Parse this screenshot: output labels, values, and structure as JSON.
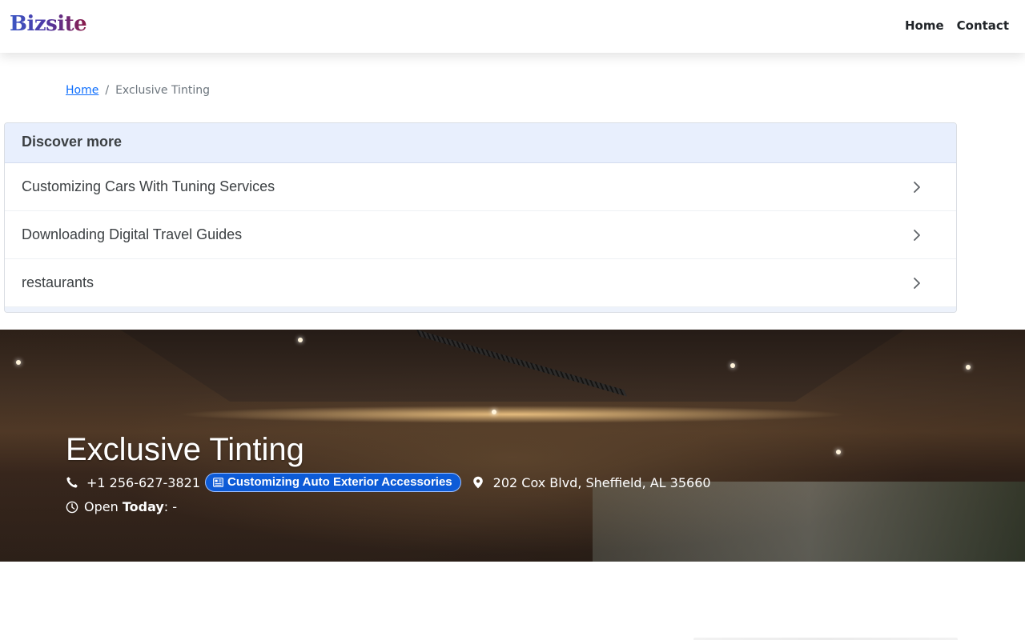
{
  "header": {
    "logo": "Bizsite",
    "nav": [
      {
        "label": "Home"
      },
      {
        "label": "Contact"
      }
    ]
  },
  "breadcrumb": {
    "home": "Home",
    "separator": "/",
    "current": "Exclusive Tinting"
  },
  "discover": {
    "title": "Discover more",
    "items": [
      {
        "label": "Customizing Cars With Tuning Services"
      },
      {
        "label": "Downloading Digital Travel Guides"
      },
      {
        "label": "restaurants"
      }
    ]
  },
  "business": {
    "name": "Exclusive Tinting",
    "phone": "+1 256-627-3821",
    "category": "Customizing Auto Exterior Accessories",
    "address": "202 Cox Blvd, Sheffield, AL 35660",
    "open_prefix": "Open",
    "open_day": "Today",
    "open_hours": ": -"
  },
  "colors": {
    "link": "#0d6efd",
    "badge": "#0d5bd7",
    "discover_header_bg": "#e8effd"
  },
  "icons": {
    "phone": "phone-icon",
    "category": "newspaper-icon",
    "address": "map-pin-icon",
    "hours": "clock-icon",
    "chevron": "chevron-right-icon"
  }
}
